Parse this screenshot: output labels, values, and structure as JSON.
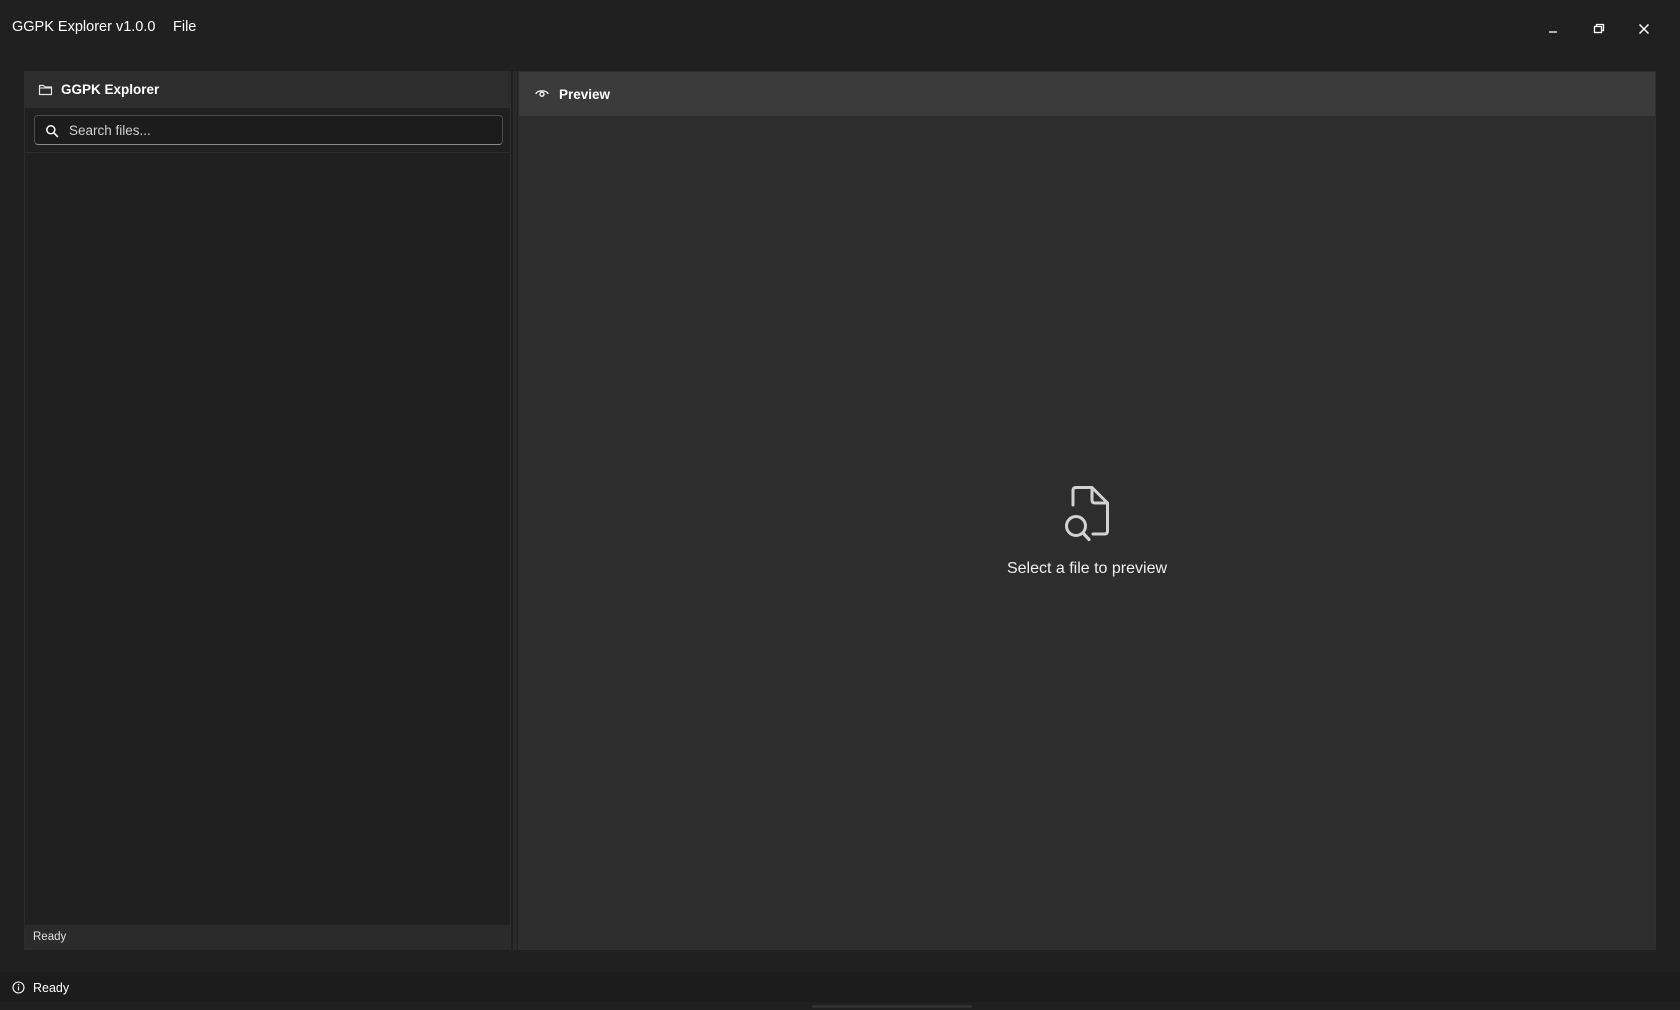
{
  "window": {
    "title": "GGPK Explorer v1.0.0",
    "menu": [
      "File"
    ],
    "controls": [
      "minimize-icon",
      "restore-icon",
      "close-icon"
    ]
  },
  "explorer": {
    "title": "GGPK Explorer",
    "icon": "folder-icon",
    "search": {
      "placeholder": "Search files...",
      "value": "",
      "icon": "search-icon"
    },
    "status": "Ready"
  },
  "preview": {
    "title": "Preview",
    "icon": "eye-icon",
    "empty_icon": "file-search-icon",
    "empty_message": "Select a file to preview"
  },
  "statusbar": {
    "icon": "info-icon",
    "text": "Ready"
  },
  "colors": {
    "background": "#202020",
    "panel_header": "#2d2d2d",
    "preview_bg": "#2d2d2d",
    "preview_header": "#3b3b3b",
    "text": "#ffffff"
  }
}
